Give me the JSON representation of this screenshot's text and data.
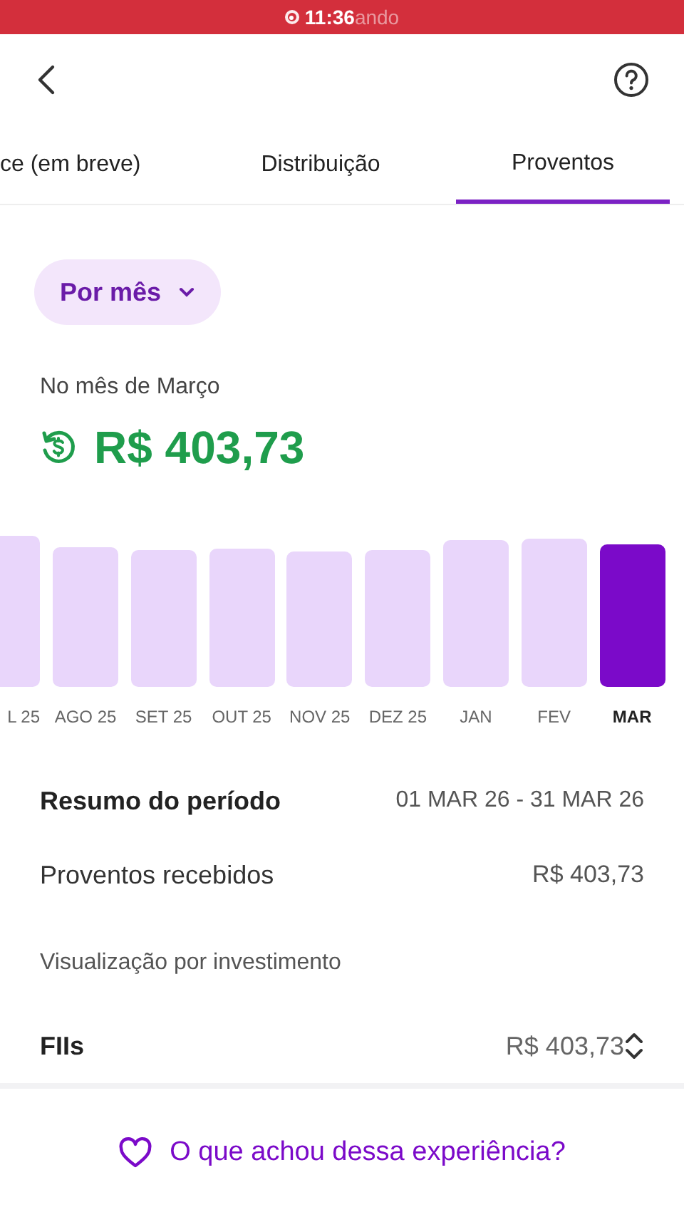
{
  "status_bar": {
    "time": "11:36",
    "recording": "ando"
  },
  "tabs": [
    {
      "label": "ce (em breve)",
      "selected": false
    },
    {
      "label": "Distribuição",
      "selected": false
    },
    {
      "label": "Proventos",
      "selected": true
    }
  ],
  "period_filter": {
    "label": "Por mês"
  },
  "month_summary": {
    "label": "No mês de Março",
    "amount": "R$ 403,73"
  },
  "months": [
    {
      "label": "L 25",
      "selected": false
    },
    {
      "label": "AGO 25",
      "selected": false
    },
    {
      "label": "SET 25",
      "selected": false
    },
    {
      "label": "OUT 25",
      "selected": false
    },
    {
      "label": "NOV 25",
      "selected": false
    },
    {
      "label": "DEZ 25",
      "selected": false
    },
    {
      "label": "JAN",
      "selected": false
    },
    {
      "label": "FEV",
      "selected": false
    },
    {
      "label": "MAR",
      "selected": true
    }
  ],
  "period_summary": {
    "title": "Resumo do período",
    "range": "01 MAR 26 - 31 MAR 26",
    "received_label": "Proventos recebidos",
    "received_value": "R$ 403,73"
  },
  "by_investment": {
    "title": "Visualização por investimento",
    "rows": [
      {
        "name": "FIIs",
        "value": "R$ 403,73"
      }
    ]
  },
  "feedback": {
    "label": "O que achou dessa experiência?"
  }
}
